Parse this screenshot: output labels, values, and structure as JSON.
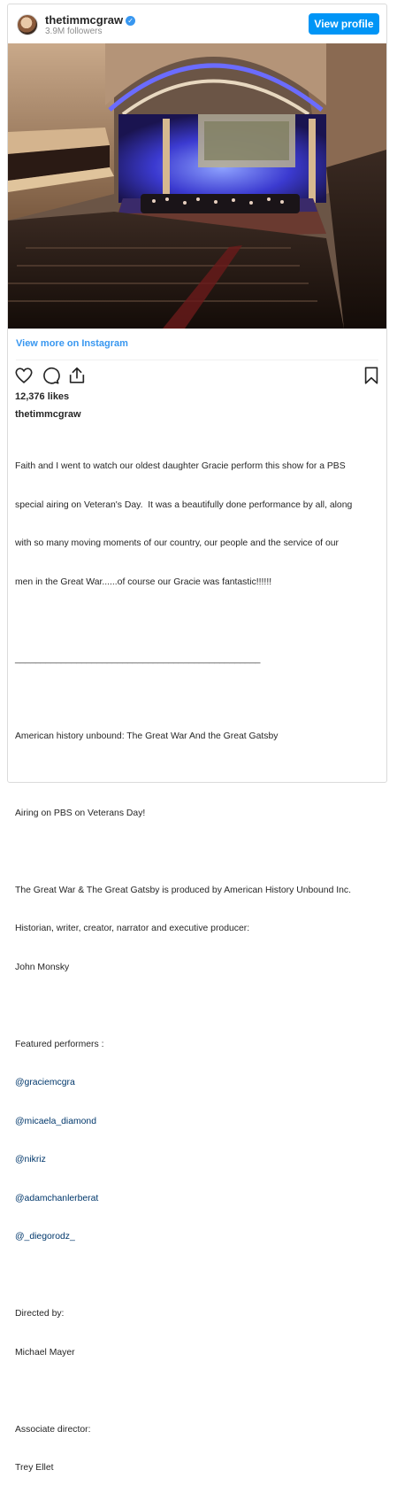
{
  "header": {
    "username": "thetimmcgraw",
    "followers": "3.9M followers",
    "view_profile_label": "View profile",
    "verified_icon": "verified-check-icon"
  },
  "view_more_label": "View more on Instagram",
  "actions": {
    "like_icon": "heart-icon",
    "comment_icon": "comment-icon",
    "share_icon": "share-icon",
    "save_icon": "bookmark-icon"
  },
  "likes": "12,376 likes",
  "owner_username": "thetimmcgraw",
  "caption": {
    "p1": [
      "Faith and I went to watch our oldest daughter Gracie perform this show for a PBS",
      "special airing on Veteran's Day.  It was a beautifully done performance by all, along",
      "with so many moving moments of our country, our people and the service of our",
      "men in the Great War......of course our Gracie was fantastic!!!!!!"
    ],
    "separator": "________________________________________________",
    "title_line": "American history unbound: The Great War And the Great Gatsby",
    "airing": "Airing on PBS on Veterans Day!",
    "produced": [
      "The Great War & The Great Gatsby is produced by American History Unbound Inc.",
      "Historian, writer, creator, narrator and executive producer:",
      "John Monsky"
    ],
    "featured_label": "Featured performers :",
    "performers": [
      "@graciemcgra",
      "@micaela_diamond",
      "@nikriz",
      "@adamchanlerberat",
      "@_diegorodz_"
    ],
    "directed_label": "Directed by:",
    "director": "Michael Mayer",
    "associate_label": "Associate director:",
    "associate": "Trey Ellet"
  }
}
